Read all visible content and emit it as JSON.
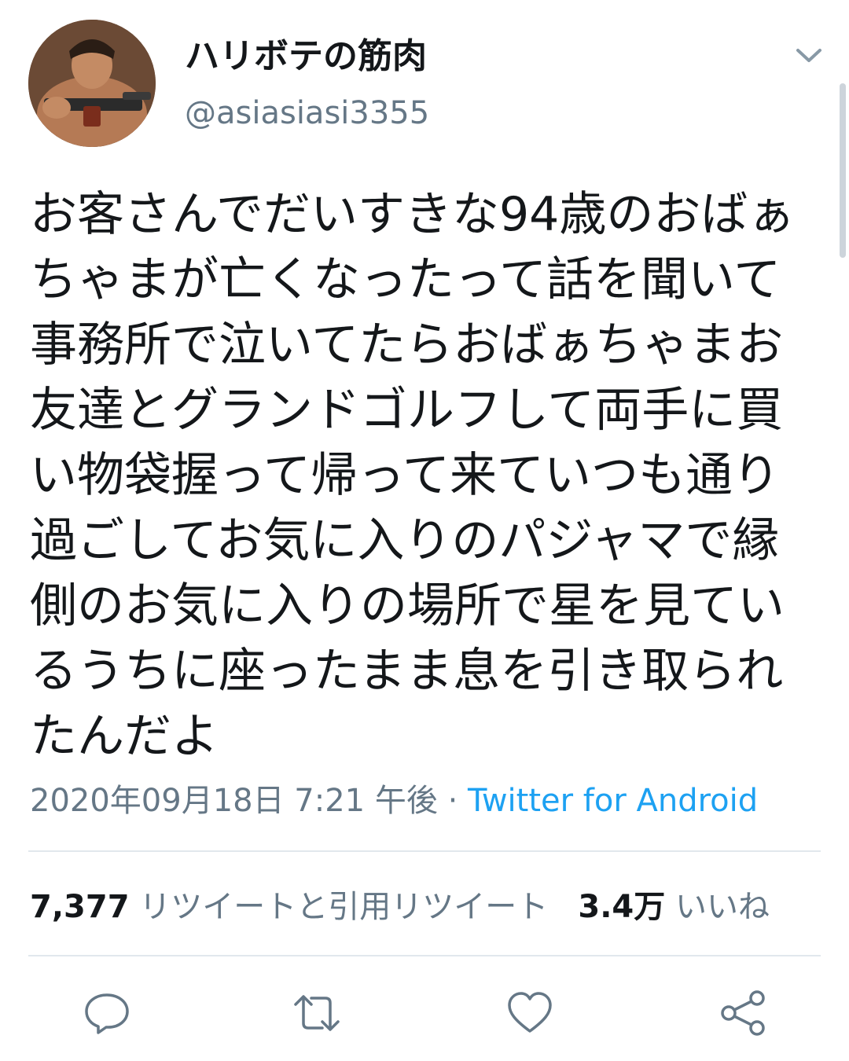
{
  "user": {
    "display_name": "ハリボテの筋肉",
    "handle": "@asiasiasi3355",
    "avatar_icon": "avatar-icon"
  },
  "tweet": {
    "text": "お客さんでだいすきな94歳のおばぁちゃまが亡くなったって話を聞いて事務所で泣いてたらおばぁちゃまお友達とグランドゴルフして両手に買い物袋握って帰って来ていつも通り過ごしてお気に入りのパジャマで縁側のお気に入りの場所で星を見ているうちに座ったまま息を引き取られたんだよ",
    "timestamp": "2020年09月18日 7:21 午後",
    "separator": " · ",
    "source": "Twitter for Android"
  },
  "stats": {
    "retweets_count": "7,377",
    "retweets_label": "リツイートと引用リツイート",
    "likes_count": "3.4万",
    "likes_label": "いいね"
  },
  "actions": {
    "reply_icon": "reply-icon",
    "retweet_icon": "retweet-icon",
    "like_icon": "heart-icon",
    "share_icon": "share-icon"
  },
  "colors": {
    "text": "#14171a",
    "secondary": "#657786",
    "link": "#1da1f2",
    "divider": "#e1e8ed"
  }
}
